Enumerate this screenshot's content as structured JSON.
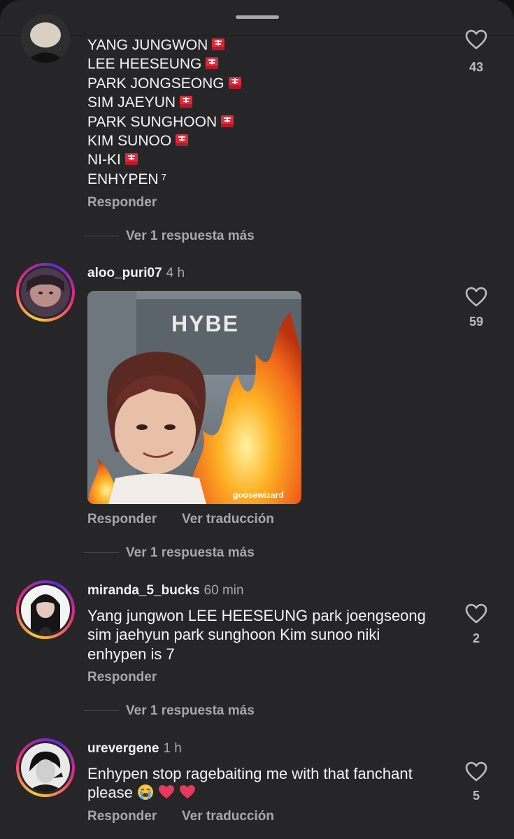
{
  "comments": [
    {
      "lines": [
        "YANG JUNGWON",
        "LEE HEESEUNG",
        "PARK JONGSEONG",
        "SIM JAEYUN",
        "PARK SUNGHOON",
        "KIM SUNOO",
        "NI-KI",
        "ENHYPEN"
      ],
      "last_suffix": "⁷",
      "reply_label": "Responder",
      "likes": "43",
      "more_replies": "Ver 1 respuesta más"
    },
    {
      "username": "aloo_puri07",
      "time": "4 h",
      "image_building_text": "HYBE",
      "image_watermark": "goosewizard",
      "reply_label": "Responder",
      "translate_label": "Ver traducción",
      "likes": "59",
      "more_replies": "Ver 1 respuesta más"
    },
    {
      "username": "miranda_5_bucks",
      "time": "60 min",
      "text": "Yang jungwon LEE HEESEUNG  park joengseong sim jaehyun  park sunghoon Kim sunoo niki enhypen is 7",
      "reply_label": "Responder",
      "likes": "2",
      "more_replies": "Ver 1 respuesta más"
    },
    {
      "username": "urevergene",
      "time": "1 h",
      "text": "Enhypen stop ragebaiting me with that fanchant please",
      "text_emojis": "😭💔💔",
      "reply_label": "Responder",
      "translate_label": "Ver traducción",
      "likes": "5"
    }
  ],
  "colors": {
    "background": "#262628",
    "text": "#f5f5f5",
    "muted": "#a8a8a8",
    "story_ring_start": "#f9ce34",
    "story_ring_mid": "#ee2a7b"
  },
  "icons": {
    "like": "heart-outline-icon",
    "siren": "rotating-light-emoji"
  }
}
